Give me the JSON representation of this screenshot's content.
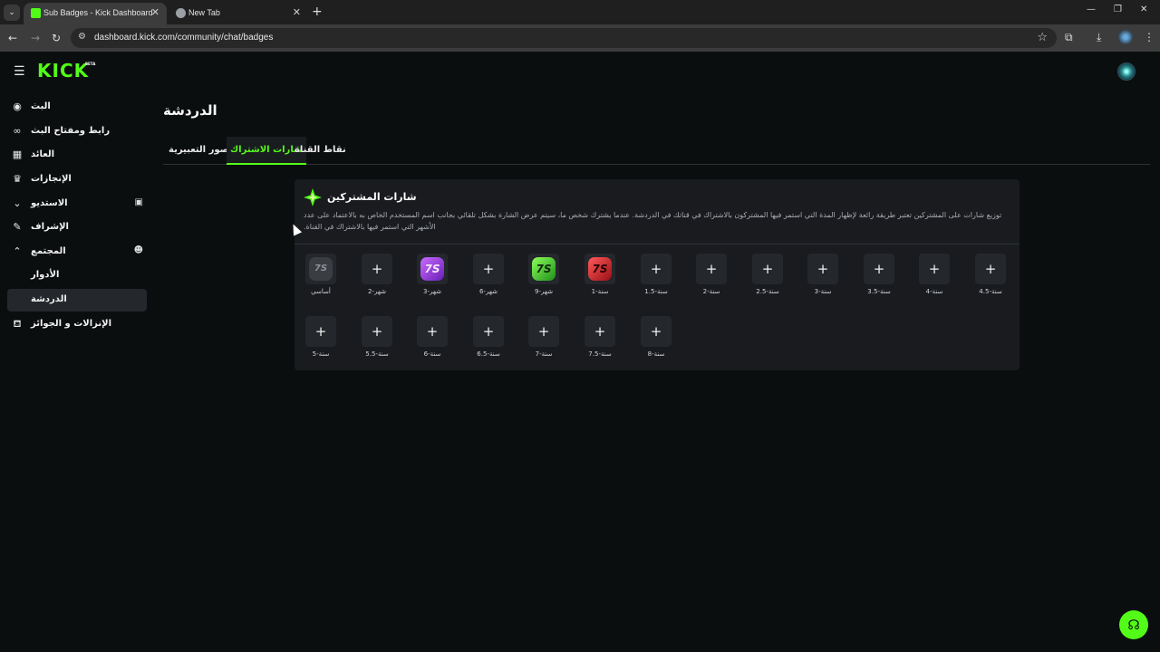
{
  "browser": {
    "tabs": [
      {
        "title": "Sub Badges - Kick Dashboard",
        "active": true
      },
      {
        "title": "New Tab",
        "active": false
      }
    ],
    "url": "dashboard.kick.com/community/chat/badges"
  },
  "app": {
    "logo": "KICK",
    "logo_badge": "BETA"
  },
  "sidebar": {
    "items": [
      {
        "label": "البث",
        "icon": "broadcast-icon"
      },
      {
        "label": "رابط ومفتاح البث",
        "icon": "link-icon"
      },
      {
        "label": "العائد",
        "icon": "revenue-icon"
      },
      {
        "label": "الإنجازات",
        "icon": "trophy-icon"
      },
      {
        "label": "الاستديو",
        "icon": "chevron-down-icon"
      },
      {
        "label": "الإشراف",
        "icon": "wrench-icon"
      },
      {
        "label": "المجتمع",
        "icon": "chevron-up-icon"
      },
      {
        "label": "الأدوار",
        "icon": ""
      },
      {
        "label": "الدردشة",
        "icon": ""
      },
      {
        "label": "الإنزالات و الجوائز",
        "icon": "gift-icon"
      }
    ]
  },
  "page": {
    "title": "الدردشة",
    "tabs": [
      "الصور التعبيرية",
      "شارات الاشتراك",
      "نقاط القناة"
    ]
  },
  "card": {
    "title": "شارات المشتركين",
    "description": "توزيع شارات على المشتركين تعتبر طريقة رائعة لإظهار المدة التي استمر فيها المشتركون بالاشتراك في قناتك في الدردشة. عندما يشترك شخص ما، سيتم عرض الشارة بشكل تلقائي بجانب اسم المستخدم الخاص به بالاعتماد على عدد الأشهر التي استمر فيها بالاشتراك في القناة.",
    "badges_row1": [
      {
        "label": "أساسي",
        "type": "base"
      },
      {
        "label": "شهر-2",
        "type": "add"
      },
      {
        "label": "شهر-3",
        "type": "purple"
      },
      {
        "label": "شهر-6",
        "type": "add"
      },
      {
        "label": "شهر-9",
        "type": "green"
      },
      {
        "label": "سنة-1",
        "type": "red"
      },
      {
        "label": "سنة-1.5",
        "type": "add"
      },
      {
        "label": "سنة-2",
        "type": "add"
      },
      {
        "label": "سنة-2.5",
        "type": "add"
      },
      {
        "label": "سنة-3",
        "type": "add"
      },
      {
        "label": "سنة-3.5",
        "type": "add"
      },
      {
        "label": "سنة-4",
        "type": "add"
      },
      {
        "label": "سنة-4.5",
        "type": "add"
      }
    ],
    "badges_row2": [
      {
        "label": "سنة-5",
        "type": "add"
      },
      {
        "label": "سنة-5.5",
        "type": "add"
      },
      {
        "label": "سنة-6",
        "type": "add"
      },
      {
        "label": "سنة-6.5",
        "type": "add"
      },
      {
        "label": "سنة-7",
        "type": "add"
      },
      {
        "label": "سنة-7.5",
        "type": "add"
      },
      {
        "label": "سنة-8",
        "type": "add"
      }
    ],
    "badge_text": "7S",
    "add_symbol": "+"
  },
  "colors": {
    "accent": "#53fc18",
    "background": "#0b0e0f",
    "card": "#191b1f"
  }
}
